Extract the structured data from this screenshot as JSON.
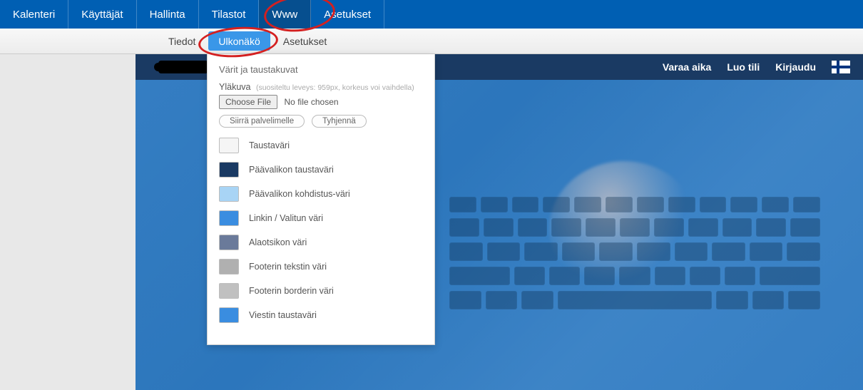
{
  "topnav": {
    "items": [
      "Kalenteri",
      "Käyttäjät",
      "Hallinta",
      "Tilastot",
      "Www",
      "Asetukset"
    ],
    "active_index": 4
  },
  "subnav": {
    "items": [
      "Tiedot",
      "Ulkonäkö",
      "Asetukset"
    ],
    "active_index": 1
  },
  "panel": {
    "heading": "Värit ja taustakuvat",
    "upload_label": "Yläkuva",
    "upload_hint": "(suositeltu leveys: 959px, korkeus voi vaihdella)",
    "choose_file": "Choose File",
    "no_file": "No file chosen",
    "btn_upload": "Siirrä palvelimelle",
    "btn_clear": "Tyhjennä",
    "swatches": [
      {
        "label": "Taustaväri",
        "color": "#f5f5f5"
      },
      {
        "label": "Päävalikon taustaväri",
        "color": "#1a3a63"
      },
      {
        "label": "Päävalikon kohdistus-väri",
        "color": "#a8d4f5"
      },
      {
        "label": "Linkin / Valitun väri",
        "color": "#3a8de0"
      },
      {
        "label": "Alaotsikon väri",
        "color": "#6a7a9a"
      },
      {
        "label": "Footerin tekstin väri",
        "color": "#b0b0b0"
      },
      {
        "label": "Footerin borderin väri",
        "color": "#c0c0c0"
      },
      {
        "label": "Viestin taustaväri",
        "color": "#3a8de0"
      }
    ]
  },
  "pagebar": {
    "links": [
      "Varaa aika",
      "Luo tili",
      "Kirjaudu"
    ]
  }
}
